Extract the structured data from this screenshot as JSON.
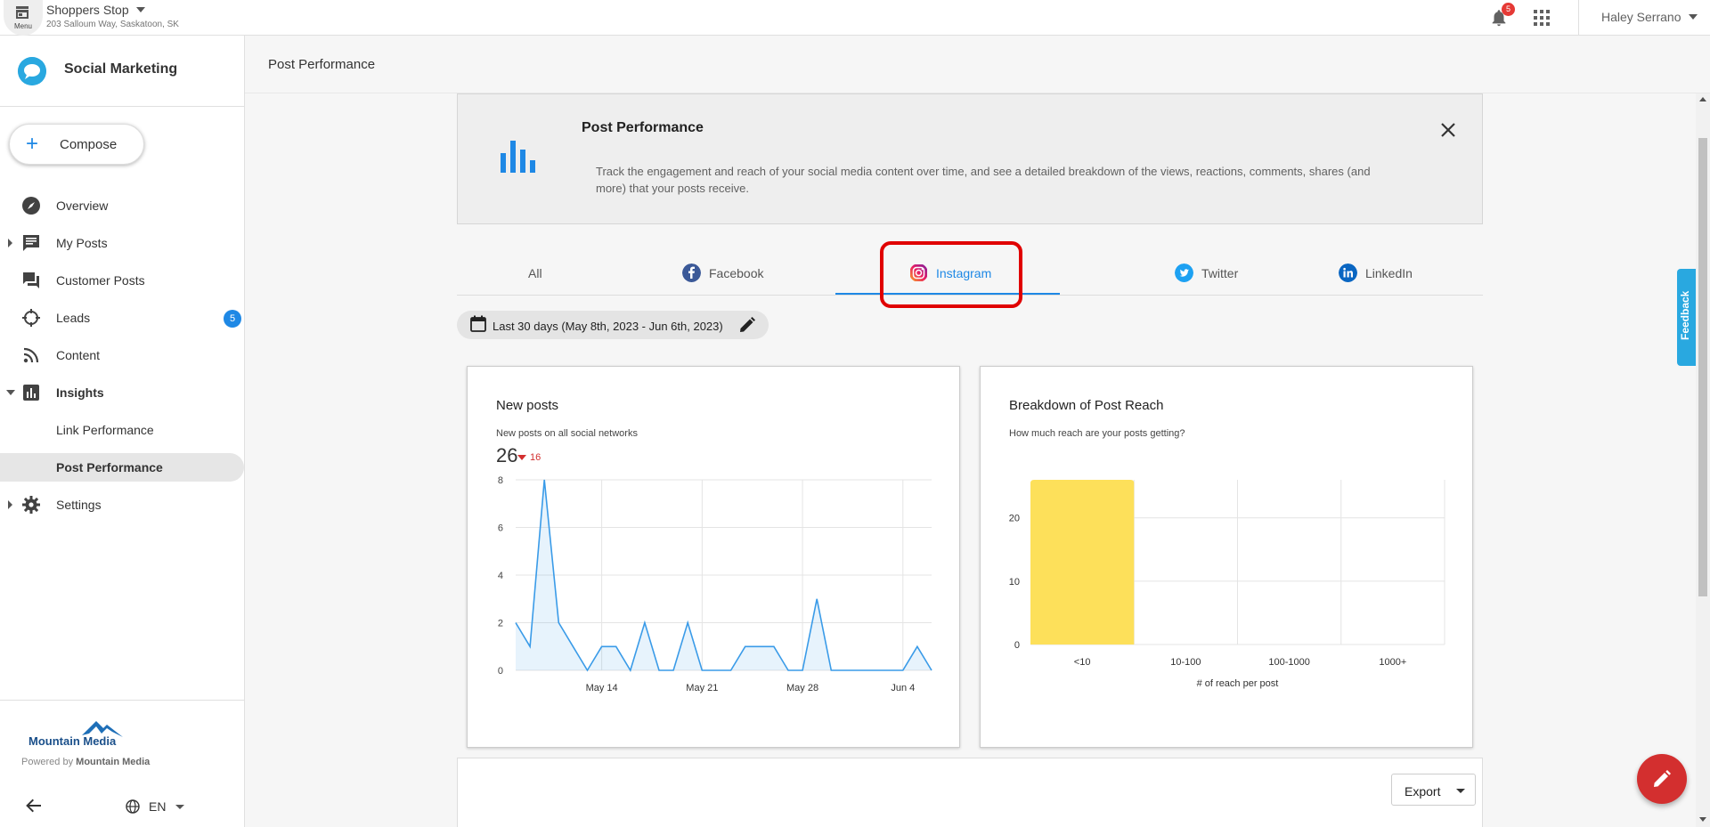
{
  "topbar": {
    "menu_label": "Menu",
    "business_name": "Shoppers Stop",
    "business_address": "203 Salloum Way, Saskatoon, SK",
    "notification_count": "5",
    "user_name": "Haley Serrano"
  },
  "sidebar": {
    "brand": "Social Marketing",
    "compose_label": "Compose",
    "items": [
      {
        "label": "Overview",
        "icon": "compass-icon"
      },
      {
        "label": "My Posts",
        "icon": "message-icon"
      },
      {
        "label": "Customer Posts",
        "icon": "forum-icon"
      },
      {
        "label": "Leads",
        "icon": "crosshair-icon",
        "badge": "5"
      },
      {
        "label": "Content",
        "icon": "rss-icon"
      },
      {
        "label": "Insights",
        "icon": "insights-icon"
      },
      {
        "label": "Link Performance"
      },
      {
        "label": "Post Performance"
      },
      {
        "label": "Settings",
        "icon": "gear-icon"
      }
    ],
    "footer": {
      "logo_text": "Mountain Media",
      "powered_prefix": "Powered by",
      "powered_brand": "Mountain Media",
      "language": "EN"
    }
  },
  "page": {
    "title": "Post Performance"
  },
  "banner": {
    "title": "Post Performance",
    "description": "Track the engagement and reach of your social media content over time, and see a detailed breakdown of the views, reactions, comments, shares (and more) that your posts receive."
  },
  "tabs": [
    {
      "label": "All"
    },
    {
      "label": "Facebook",
      "icon": "facebook-icon"
    },
    {
      "label": "Instagram",
      "icon": "instagram-icon",
      "active": true
    },
    {
      "label": "Twitter",
      "icon": "twitter-icon"
    },
    {
      "label": "LinkedIn",
      "icon": "linkedin-icon"
    }
  ],
  "date_range": "Last 30 days (May 8th, 2023 - Jun 6th, 2023)",
  "new_posts_card": {
    "title": "New posts",
    "subtitle": "New posts on all social networks",
    "total": "26",
    "delta": "16"
  },
  "reach_card": {
    "title": "Breakdown of Post Reach",
    "subtitle": "How much reach are your posts getting?"
  },
  "chart_data": [
    {
      "type": "area",
      "title": "New posts",
      "x": [
        "May 8",
        "May 9",
        "May 10",
        "May 11",
        "May 12",
        "May 13",
        "May 14",
        "May 15",
        "May 16",
        "May 17",
        "May 18",
        "May 19",
        "May 20",
        "May 21",
        "May 22",
        "May 23",
        "May 24",
        "May 25",
        "May 26",
        "May 27",
        "May 28",
        "May 29",
        "May 30",
        "May 31",
        "Jun 1",
        "Jun 2",
        "Jun 3",
        "Jun 4",
        "Jun 5",
        "Jun 6"
      ],
      "values": [
        2,
        1,
        8,
        2,
        1,
        0,
        1,
        1,
        0,
        2,
        0,
        0,
        2,
        0,
        0,
        0,
        1,
        1,
        1,
        0,
        0,
        3,
        0,
        0,
        0,
        0,
        0,
        0,
        1,
        0
      ],
      "x_tick_labels": [
        "May 14",
        "May 21",
        "May 28",
        "Jun 4"
      ],
      "y_ticks": [
        0,
        2,
        4,
        6,
        8
      ],
      "ylim": [
        0,
        8
      ],
      "color": "#3a9be8"
    },
    {
      "type": "bar",
      "title": "Breakdown of Post Reach",
      "categories": [
        "<10",
        "10-100",
        "100-1000",
        "1000+"
      ],
      "values": [
        26,
        0,
        0,
        0
      ],
      "y_ticks": [
        0,
        10,
        20
      ],
      "ylim": [
        0,
        26
      ],
      "xlabel": "# of reach per post",
      "color": "#fde05a"
    }
  ],
  "export_label": "Export",
  "feedback_label": "Feedback"
}
